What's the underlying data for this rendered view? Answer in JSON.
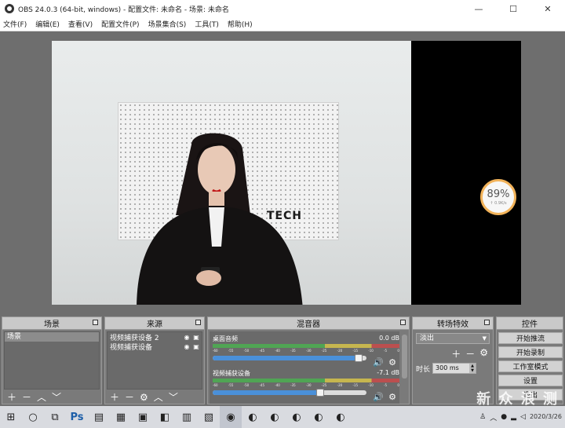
{
  "window": {
    "title": "OBS 24.0.3 (64-bit, windows) - 配置文件: 未命名 - 场景: 未命名",
    "controls": {
      "minimize": "—",
      "maximize": "☐",
      "close": "✕"
    }
  },
  "menu": [
    {
      "label": "文件(F)"
    },
    {
      "label": "编辑(E)"
    },
    {
      "label": "查看(V)"
    },
    {
      "label": "配置文件(P)"
    },
    {
      "label": "场景集合(S)"
    },
    {
      "label": "工具(T)"
    },
    {
      "label": "帮助(H)"
    }
  ],
  "preview": {
    "brand_text": "TECH",
    "gauge_percent": "89%",
    "gauge_speed": "↑ 0.9K/s",
    "gauge_color": "#f2b35a"
  },
  "docks": {
    "scenes": {
      "title": "场景",
      "items": [
        "场景"
      ]
    },
    "sources": {
      "title": "来源",
      "items": [
        {
          "name": "视频捕获设备 2"
        },
        {
          "name": "视频捕获设备"
        }
      ]
    },
    "mixer": {
      "title": "混音器",
      "tracks": [
        {
          "name": "桌面音频",
          "level": "0.0 dB",
          "volume_fraction": 0.95
        },
        {
          "name": "视频捕获设备",
          "level": "-7.1 dB",
          "volume_fraction": 0.7
        }
      ],
      "ticks": [
        "-60",
        "-55",
        "-50",
        "-45",
        "-40",
        "-35",
        "-30",
        "-25",
        "-20",
        "-15",
        "-10",
        "-5",
        "0"
      ]
    },
    "transitions": {
      "title": "转场特效",
      "selected": "淡出",
      "duration_label": "时长",
      "duration_value": "300 ms"
    },
    "controls": {
      "title": "控件",
      "buttons": [
        "开始推流",
        "开始录制",
        "工作室模式",
        "设置",
        "退出"
      ]
    }
  },
  "taskbar": {
    "date": "2020/3/26",
    "watermark": "新 众 浪 测"
  },
  "colors": {
    "accent_blue": "#4a90d9",
    "dock_bg": "#7a7a7a"
  }
}
